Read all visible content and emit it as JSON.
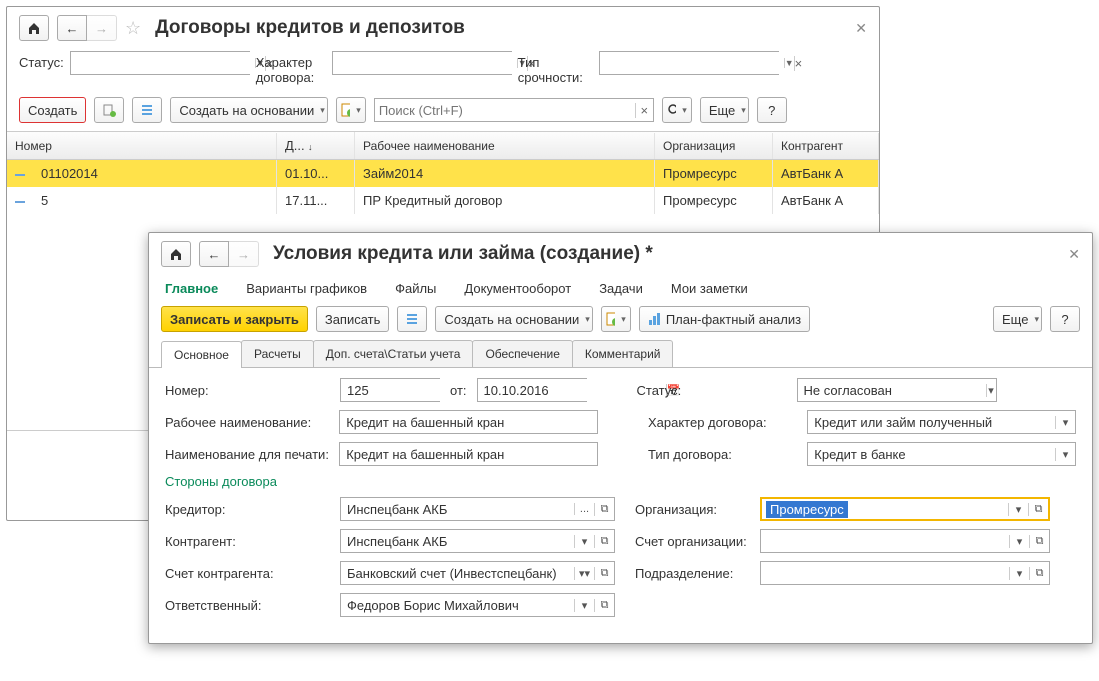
{
  "w1": {
    "title": "Договоры кредитов и депозитов",
    "filters": {
      "status_label": "Статус:",
      "char_label": "Характер договора:",
      "type_label": "Тип срочности:"
    },
    "toolbar": {
      "create": "Создать",
      "create_based": "Создать на основании",
      "search_ph": "Поиск (Ctrl+F)",
      "more": "Еще",
      "help": "?"
    },
    "columns": {
      "num": "Номер",
      "date": "Д...",
      "name": "Рабочее наименование",
      "org": "Организация",
      "ka": "Контрагент"
    },
    "rows": [
      {
        "num": "01102014",
        "date": "01.10...",
        "name": "Займ2014",
        "org": "Промресурс",
        "ka": "АвтБанк А"
      },
      {
        "num": "5",
        "date": "17.11...",
        "name": "ПР Кредитный договор",
        "org": "Промресурс",
        "ka": "АвтБанк А"
      }
    ]
  },
  "w2": {
    "title": "Условия кредита или займа (создание) *",
    "nav": [
      "Главное",
      "Варианты графиков",
      "Файлы",
      "Документооборот",
      "Задачи",
      "Мои заметки"
    ],
    "toolbar": {
      "save_close": "Записать и закрыть",
      "save": "Записать",
      "create_based": "Создать на основании",
      "plan_fact": "План-фактный анализ",
      "more": "Еще",
      "help": "?"
    },
    "subtabs": [
      "Основное",
      "Расчеты",
      "Доп. счета\\Статьи учета",
      "Обеспечение",
      "Комментарий"
    ],
    "form": {
      "number_lbl": "Номер:",
      "number": "125",
      "from_lbl": "от:",
      "date": "10.10.2016",
      "status_lbl": "Статус:",
      "status": "Не согласован",
      "workname_lbl": "Рабочее наименование:",
      "workname": "Кредит на башенный кран",
      "char_lbl": "Характер договора:",
      "char": "Кредит или займ полученный",
      "printname_lbl": "Наименование для печати:",
      "printname": "Кредит на башенный кран",
      "type_lbl": "Тип договора:",
      "type": "Кредит в банке",
      "section": "Стороны договора",
      "creditor_lbl": "Кредитор:",
      "creditor": "Инспецбанк АКБ",
      "org_lbl": "Организация:",
      "org": "Промресурс",
      "ka_lbl": "Контрагент:",
      "ka": "Инспецбанк АКБ",
      "orgacc_lbl": "Счет организации:",
      "orgacc": "",
      "kaacc_lbl": "Счет контрагента:",
      "kaacc": "Банковский счет (Инвестспецбанк)",
      "dept_lbl": "Подразделение:",
      "dept": "",
      "resp_lbl": "Ответственный:",
      "resp": "Федоров Борис Михайлович"
    }
  }
}
